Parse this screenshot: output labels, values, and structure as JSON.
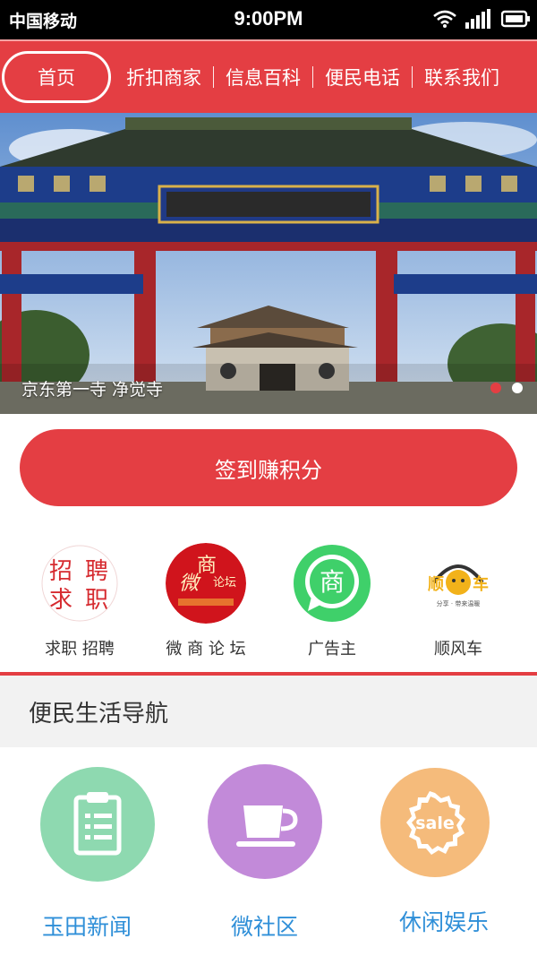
{
  "status": {
    "carrier": "中国移动",
    "time": "9:00PM"
  },
  "nav": {
    "home": "首页",
    "items": [
      "折扣商家",
      "信息百科",
      "便民电话",
      "联系我们"
    ]
  },
  "banner": {
    "caption": "京东第一寺 净觉寺",
    "slide_count": 2,
    "active_slide": 1
  },
  "checkin": {
    "label": "签到赚积分"
  },
  "quick_links": [
    {
      "label": "求职 招聘",
      "icon": "job-icon",
      "icon_text": [
        "招",
        "聘",
        "求",
        "职"
      ]
    },
    {
      "label": "微 商 论 坛",
      "icon": "forum-icon",
      "icon_text": [
        "微",
        "商",
        "论坛"
      ]
    },
    {
      "label": "广告主",
      "icon": "merchant-icon",
      "icon_text": [
        "商"
      ]
    },
    {
      "label": "顺风车",
      "icon": "carpool-icon",
      "icon_text": [
        "顺",
        "车",
        "分享 · 带来温暖"
      ]
    }
  ],
  "life_nav": {
    "title": "便民生活导航",
    "items": [
      {
        "label": "玉田新闻",
        "icon": "clipboard-icon",
        "color": "#8ed9b0"
      },
      {
        "label": "微社区",
        "icon": "coffee-cup-icon",
        "color": "#c28ad9"
      },
      {
        "label": "休闲娱乐",
        "icon": "sale-badge-icon",
        "color": "#f5bb7b",
        "icon_text": "sale"
      }
    ]
  },
  "colors": {
    "brand_red": "#e43e43",
    "link_blue": "#2f8fd8"
  }
}
